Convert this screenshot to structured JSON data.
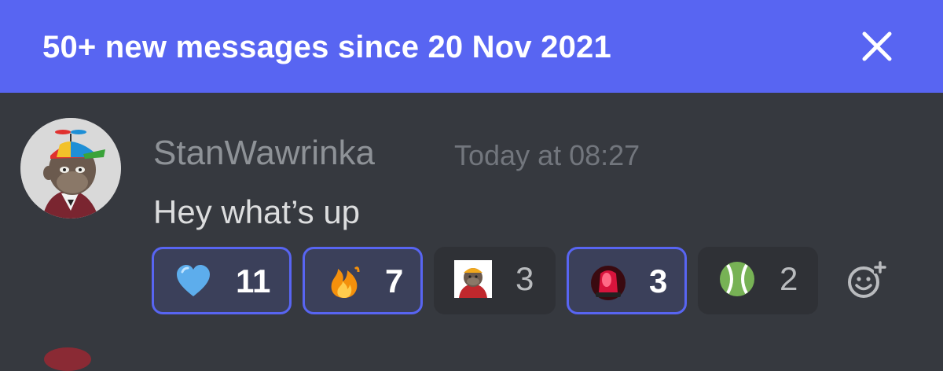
{
  "banner": {
    "text": "50+ new messages since 20 Nov 2021",
    "close_icon": "close-icon",
    "bg_color": "#5865f2"
  },
  "message": {
    "username": "StanWawrinka",
    "timestamp": "Today at 08:27",
    "content": "Hey what’s up",
    "avatar_icon": "ape-avatar"
  },
  "reactions": [
    {
      "emoji": "blue-heart",
      "count": "11",
      "active": true
    },
    {
      "emoji": "fire",
      "count": "7",
      "active": true
    },
    {
      "emoji": "ape-custom-emoji",
      "count": "3",
      "active": false
    },
    {
      "emoji": "siren-light",
      "count": "3",
      "active": true
    },
    {
      "emoji": "tennis-ball",
      "count": "2",
      "active": false
    }
  ],
  "add_reaction_icon": "add-reaction-icon",
  "colors": {
    "background": "#36393f",
    "accent": "#5865f2",
    "username": "#8e9297",
    "timestamp": "#72767d",
    "text": "#dcddde"
  }
}
